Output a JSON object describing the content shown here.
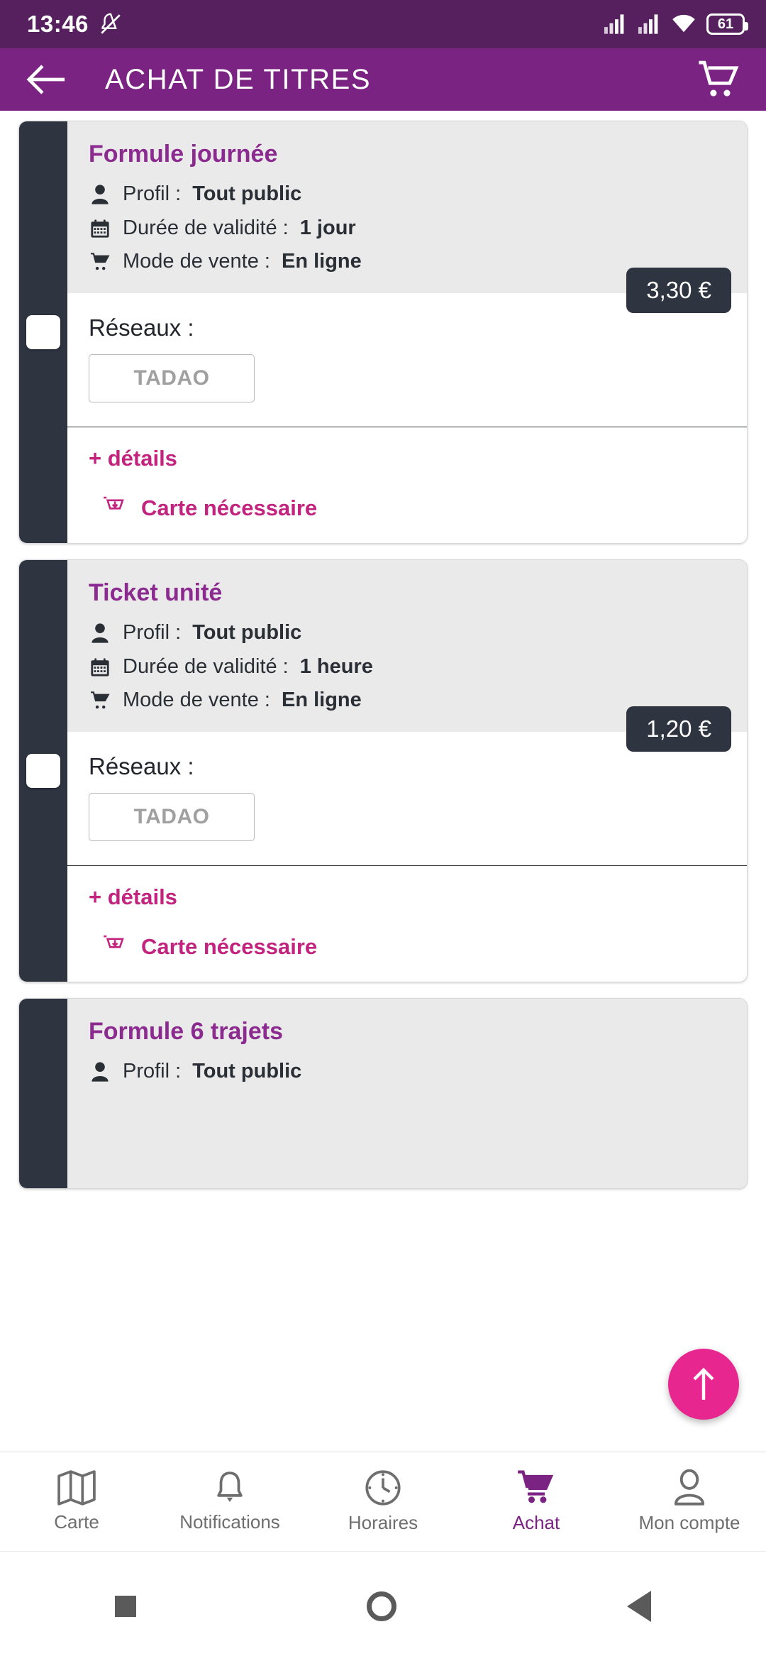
{
  "statusbar": {
    "time": "13:46",
    "mute_icon": "bell-muted-icon",
    "signal1_icon": "signal-bars-icon",
    "signal2_icon": "signal-bars-icon",
    "wifi_icon": "wifi-icon",
    "battery_level": "61"
  },
  "appbar": {
    "back_icon": "back-arrow-icon",
    "title": "ACHAT DE TITRES",
    "cart_icon": "shopping-cart-icon"
  },
  "labels": {
    "profil": "Profil :",
    "duree": "Durée de validité :",
    "mode": "Mode de vente :",
    "reseaux": "Réseaux :",
    "details": "+ détails",
    "carte_necessaire": "Carte nécessaire"
  },
  "colors": {
    "statusbar": "#56205F",
    "appbar": "#7B2382",
    "card_rail": "#2E3440",
    "card_head": "#EAEAEA",
    "title_purple": "#8B2A8F",
    "accent_magenta": "#C2237E",
    "fab_pink": "#E8268F",
    "price_badge": "#2E3440"
  },
  "cards": [
    {
      "title": "Formule journée",
      "profil": "Tout public",
      "duree": "1 jour",
      "mode": "En ligne",
      "price": "3,30 €",
      "network": "TADAO",
      "checkbox_checked": false
    },
    {
      "title": "Ticket unité",
      "profil": "Tout public",
      "duree": "1 heure",
      "mode": "En ligne",
      "price": "1,20 €",
      "network": "TADAO",
      "checkbox_checked": false
    },
    {
      "title": "Formule 6 trajets",
      "profil": "Tout public",
      "duree": "",
      "mode": "",
      "price": "",
      "network": "",
      "checkbox_checked": false
    }
  ],
  "fab": {
    "icon": "arrow-up-icon"
  },
  "bottomnav": {
    "items": [
      {
        "label": "Carte",
        "icon": "map-icon",
        "active": false
      },
      {
        "label": "Notifications",
        "icon": "bell-icon",
        "active": false
      },
      {
        "label": "Horaires",
        "icon": "clock-icon",
        "active": false
      },
      {
        "label": "Achat",
        "icon": "shopping-cart-icon",
        "active": true
      },
      {
        "label": "Mon compte",
        "icon": "person-icon",
        "active": false
      }
    ]
  },
  "sysnav": {
    "recents_icon": "square-icon",
    "home_icon": "circle-icon",
    "back_icon": "triangle-back-icon"
  }
}
